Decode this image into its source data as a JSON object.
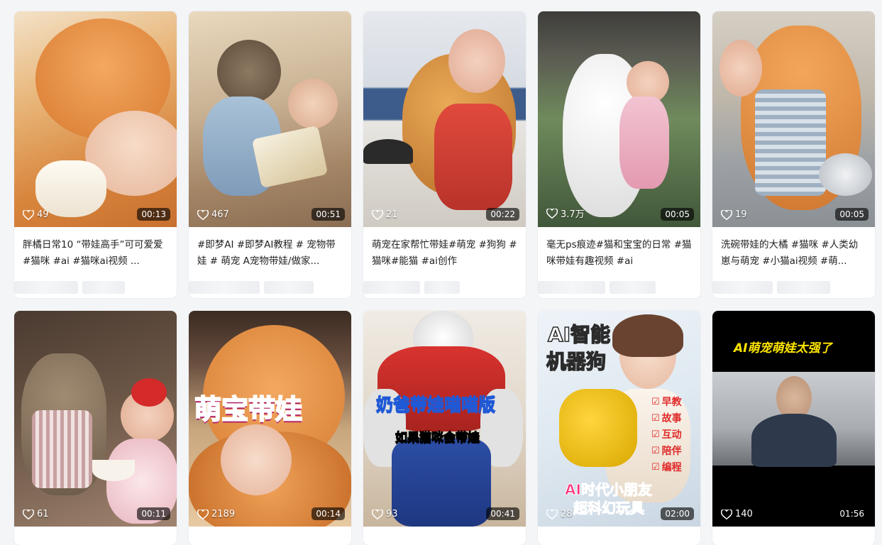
{
  "cards": [
    {
      "likes": "49",
      "duration": "00:13",
      "caption": "胖橘日常10 “带娃高手”可可爱爱#猫咪 #ai #猫咪ai视频 ..."
    },
    {
      "likes": "467",
      "duration": "00:51",
      "caption": "#即梦AI #即梦AI教程 # 宠物带娃 # 萌宠 A宠物带娃/做家..."
    },
    {
      "likes": "21",
      "duration": "00:22",
      "caption": "萌宠在家帮忙带娃#萌宠 #狗狗 #猫咪#能猫 #ai创作"
    },
    {
      "likes": "3.7万",
      "duration": "00:05",
      "caption": "毫无ps痕迹#猫和宝宝的日常 #猫咪带娃有趣视频 #ai"
    },
    {
      "likes": "19",
      "duration": "00:05",
      "caption": "洗碗带娃的大橘 #猫咪 #人类幼崽与萌宠 #小猫ai视频 #萌..."
    },
    {
      "likes": "61",
      "duration": "00:11",
      "overlay": []
    },
    {
      "likes": "2189",
      "duration": "00:14",
      "overlay": [
        "萌宝带娃"
      ]
    },
    {
      "likes": "93",
      "duration": "00:41",
      "overlay": [
        "奶爸带娃喵喵版",
        "如果猫咪会带娃"
      ]
    },
    {
      "likes": "28",
      "duration": "02:00",
      "overlay": [
        "AI智能",
        "机器狗",
        "早教",
        "故事",
        "互动",
        "陪伴",
        "编程",
        "AI时代小朋友",
        "超科幻玩具"
      ]
    },
    {
      "likes": "140",
      "duration": "01:56",
      "overlay": [
        "AI萌宠萌娃太强了"
      ]
    }
  ]
}
